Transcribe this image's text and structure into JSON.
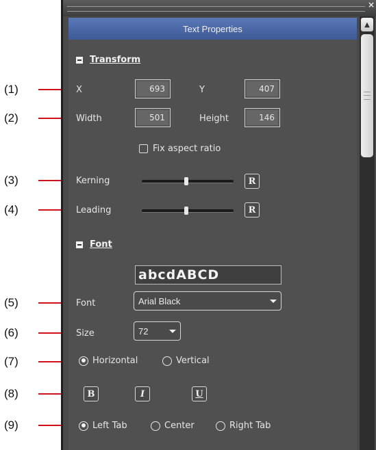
{
  "callouts": [
    "(1)",
    "(2)",
    "(3)",
    "(4)",
    "(5)",
    "(6)",
    "(7)",
    "(8)",
    "(9)"
  ],
  "panel": {
    "title": "Text Properties",
    "close_glyph": "×",
    "scroll_up_glyph": "▲"
  },
  "transform": {
    "section_label": "Transform",
    "x_label": "X",
    "x_value": "693",
    "y_label": "Y",
    "y_value": "407",
    "width_label": "Width",
    "width_value": "501",
    "height_label": "Height",
    "height_value": "146",
    "fix_aspect_label": "Fix aspect ratio",
    "fix_aspect_checked": false,
    "kerning_label": "Kerning",
    "kerning_level": 0.5,
    "leading_label": "Leading",
    "leading_level": 0.5,
    "reset_label": "R"
  },
  "font": {
    "section_label": "Font",
    "preview_text": "abcdABCD",
    "font_label": "Font",
    "font_value": "Arial Black",
    "size_label": "Size",
    "size_value": "72",
    "orientation_options": [
      "Horizontal",
      "Vertical"
    ],
    "orientation_selected": "Horizontal",
    "bold_label": "B",
    "italic_label": "I",
    "underline_label": "U",
    "tab_options": [
      "Left Tab",
      "Center",
      "Right Tab"
    ],
    "tab_selected": "Left Tab"
  },
  "colors": {
    "annotation_line": "#d0101a",
    "title_bar": "#4a68a8",
    "panel_bg": "#505050"
  }
}
